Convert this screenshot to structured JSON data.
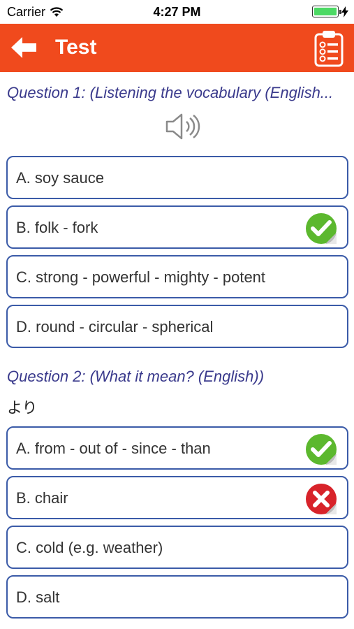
{
  "status_bar": {
    "carrier": "Carrier",
    "time": "4:27 PM",
    "battery_color": "#4cd964"
  },
  "nav": {
    "title": "Test",
    "bar_color": "#f04a1d",
    "back_icon": "arrow-left-icon",
    "right_icon": "clipboard-checklist-icon"
  },
  "question1": {
    "prompt": "Question 1: (Listening the vocabulary (English...",
    "audio_icon": "speaker-icon",
    "options": [
      {
        "label": "A. soy sauce",
        "status": ""
      },
      {
        "label": "B. folk - fork",
        "status": "correct"
      },
      {
        "label": "C. strong - powerful - mighty - potent",
        "status": ""
      },
      {
        "label": "D. round - circular - spherical",
        "status": ""
      }
    ]
  },
  "question2": {
    "prompt": "Question 2: (What it mean? (English))",
    "word": "より",
    "options": [
      {
        "label": "A. from - out of - since - than",
        "status": "correct"
      },
      {
        "label": "B. chair",
        "status": "wrong"
      },
      {
        "label": "C. cold (e.g. weather)",
        "status": ""
      },
      {
        "label": "D. salt",
        "status": ""
      }
    ]
  },
  "colors": {
    "correct": "#5cb82e",
    "wrong": "#d8232a",
    "option_border": "#3b5ba8",
    "question_text": "#3a3a8c"
  }
}
